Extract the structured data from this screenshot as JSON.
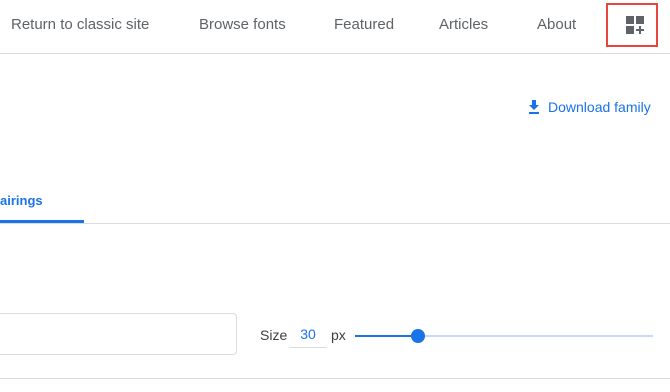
{
  "nav": {
    "return_label": "Return to classic site",
    "browse_label": "Browse fonts",
    "featured_label": "Featured",
    "articles_label": "Articles",
    "about_label": "About",
    "collection_icon": "dashboard-customize-icon"
  },
  "actions": {
    "download_label": "Download family",
    "download_icon": "download-icon"
  },
  "tabs": {
    "active_label": "airings"
  },
  "preview": {
    "size_label": "Size",
    "size_value": "30",
    "size_unit": "px",
    "slider_fraction": 0.21
  },
  "colors": {
    "accent": "#1a73e8",
    "highlight_border": "#e8453c"
  }
}
